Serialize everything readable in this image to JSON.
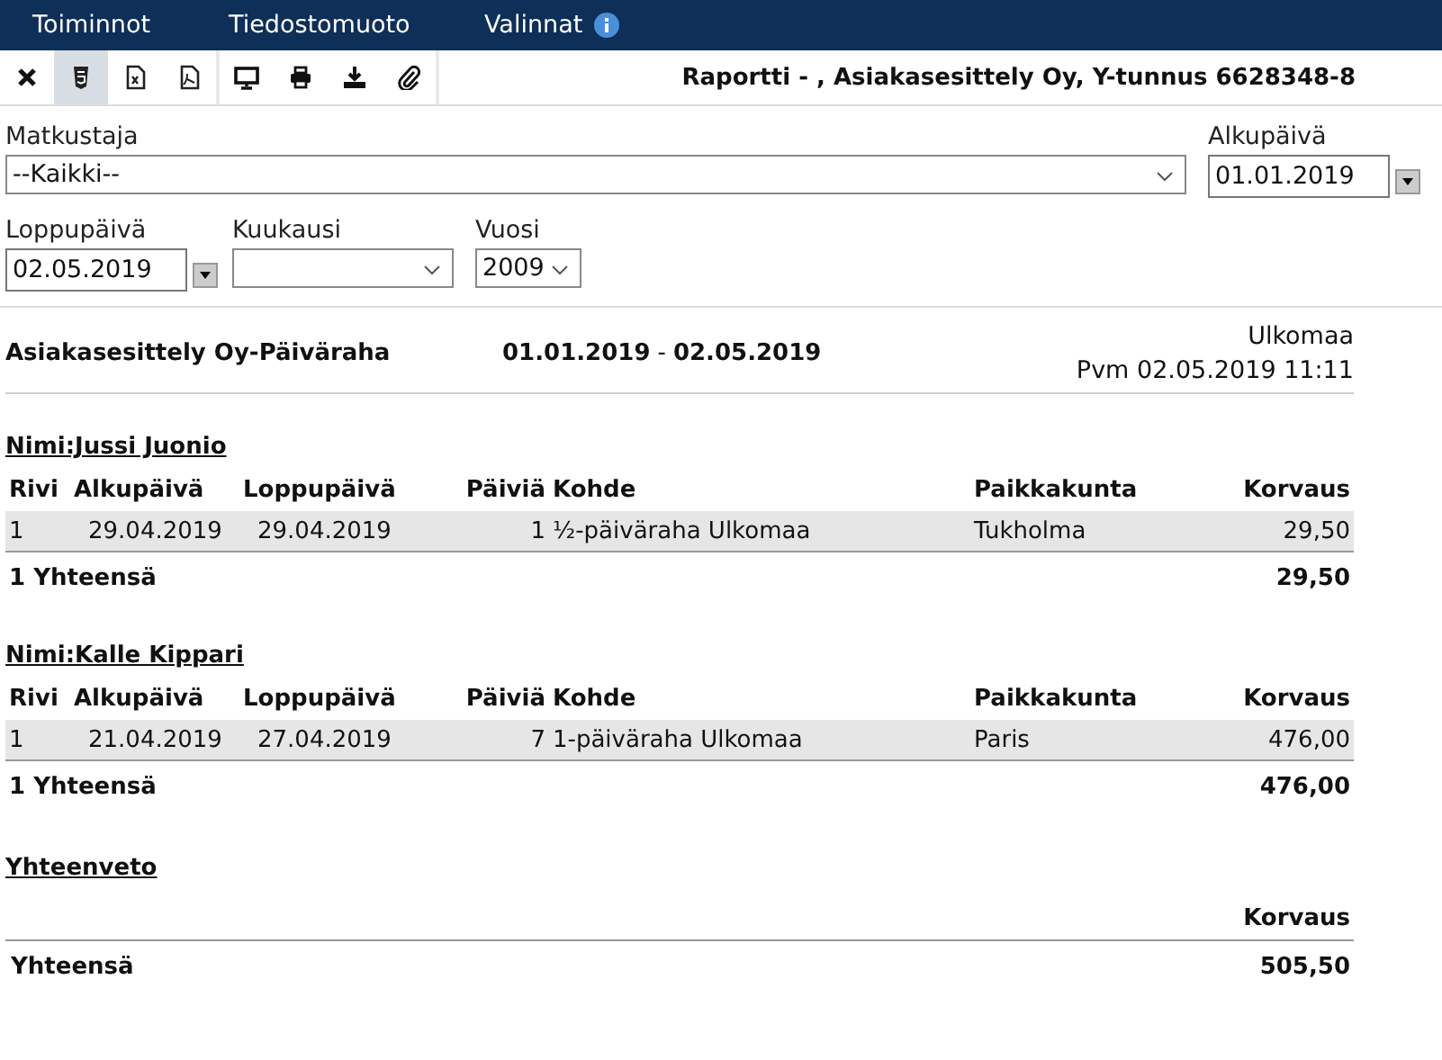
{
  "menu": [
    {
      "label": "Toiminnot",
      "info": false
    },
    {
      "label": "Tiedostomuoto",
      "info": false
    },
    {
      "label": "Valinnat",
      "info": true
    }
  ],
  "toolbar": {
    "groups": [
      [
        {
          "kind": "close",
          "selected": false
        },
        {
          "kind": "html",
          "selected": true
        },
        {
          "kind": "excel",
          "selected": false
        },
        {
          "kind": "pdf",
          "selected": false
        }
      ],
      [
        {
          "kind": "screen",
          "selected": false
        },
        {
          "kind": "print",
          "selected": false
        },
        {
          "kind": "download",
          "selected": false
        },
        {
          "kind": "attach",
          "selected": false
        }
      ]
    ],
    "title": "Raportti - , Asiakasesittely Oy, Y-tunnus 6628348-8"
  },
  "filters": {
    "traveller": {
      "label": "Matkustaja",
      "value": "--Kaikki--"
    },
    "start_date": {
      "label": "Alkupäivä",
      "value": "01.01.2019"
    },
    "end_date": {
      "label": "Loppupäivä",
      "value": "02.05.2019"
    },
    "month": {
      "label": "Kuukausi"
    },
    "year": {
      "label": "Vuosi",
      "value": "2009"
    }
  },
  "report": {
    "title": "Asiakasesittely Oy-Päiväraha",
    "from": "01.01.2019",
    "separator": "-",
    "to": "02.05.2019",
    "scope": "Ulkomaa",
    "printed": "Pvm 02.05.2019 11:11"
  },
  "groups": [
    {
      "name": "Nimi:Jussi Juonio",
      "columns": [
        "Rivi",
        "Alkupäivä",
        "Loppupäivä",
        "Päiviä",
        "Kohde",
        "Paikkakunta",
        "Korvaus"
      ],
      "rows": [
        [
          "1",
          "29.04.2019",
          "29.04.2019",
          "1",
          "½-päiväraha Ulkomaa",
          "Tukholma",
          "29,50"
        ]
      ],
      "total_label": "1 Yhteensä",
      "total": "29,50"
    },
    {
      "name": "Nimi:Kalle Kippari",
      "columns": [
        "Rivi",
        "Alkupäivä",
        "Loppupäivä",
        "Päiviä",
        "Kohde",
        "Paikkakunta",
        "Korvaus"
      ],
      "rows": [
        [
          "1",
          "21.04.2019",
          "27.04.2019",
          "7",
          "1-päiväraha Ulkomaa",
          "Paris",
          "476,00"
        ]
      ],
      "total_label": "1 Yhteensä",
      "total": "476,00"
    }
  ],
  "summary": {
    "title": "Yhteenveto",
    "column": "Korvaus",
    "total_label": "Yhteensä",
    "total": "505,50"
  }
}
